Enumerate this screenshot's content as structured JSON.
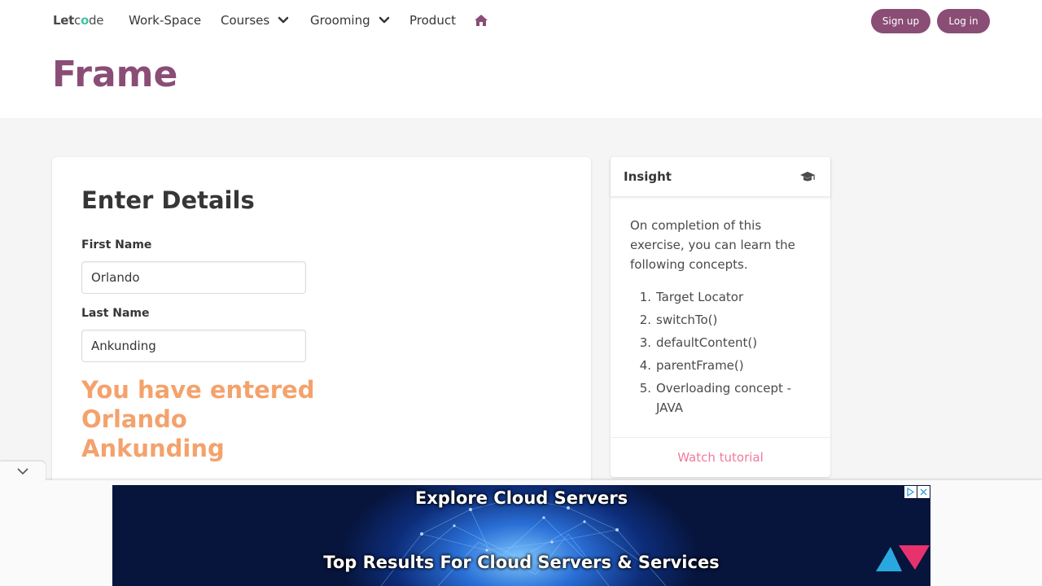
{
  "nav": {
    "logo_let": "Let",
    "logo_c": "c",
    "logo_o": "o",
    "logo_de": "de",
    "items": [
      "Work-Space",
      "Courses",
      "Grooming",
      "Product"
    ],
    "signup": "Sign up",
    "login": "Log in"
  },
  "page": {
    "title": "Frame"
  },
  "form": {
    "title": "Enter Details",
    "first_label": "First Name",
    "first_value": "Orlando",
    "last_label": "Last Name",
    "last_value": "Ankunding",
    "result_line1": "You have entered",
    "result_line2": "Orlando",
    "result_line3": "Ankunding"
  },
  "insight": {
    "title": "Insight",
    "intro": "On completion of this exercise, you can learn the following concepts.",
    "items": [
      {
        "num": "1.",
        "text": "Target Locator"
      },
      {
        "num": "2.",
        "text": "switchTo()"
      },
      {
        "num": "3.",
        "text": "defaultContent()"
      },
      {
        "num": "4.",
        "text": "parentFrame()"
      },
      {
        "num": "5.",
        "text": "Overloading concept - JAVA"
      }
    ],
    "watch": "Watch tutorial"
  },
  "ad": {
    "title": "Explore Cloud Servers",
    "subtitle": "Top Results For Cloud Servers & Services"
  },
  "colors": {
    "brand": "#8a4d76",
    "result": "#f4a26c",
    "link": "#f07a9b"
  },
  "icons": [
    "chevron-down-icon",
    "home-icon",
    "graduation-cap-icon",
    "ad-choices-icon",
    "close-icon"
  ]
}
